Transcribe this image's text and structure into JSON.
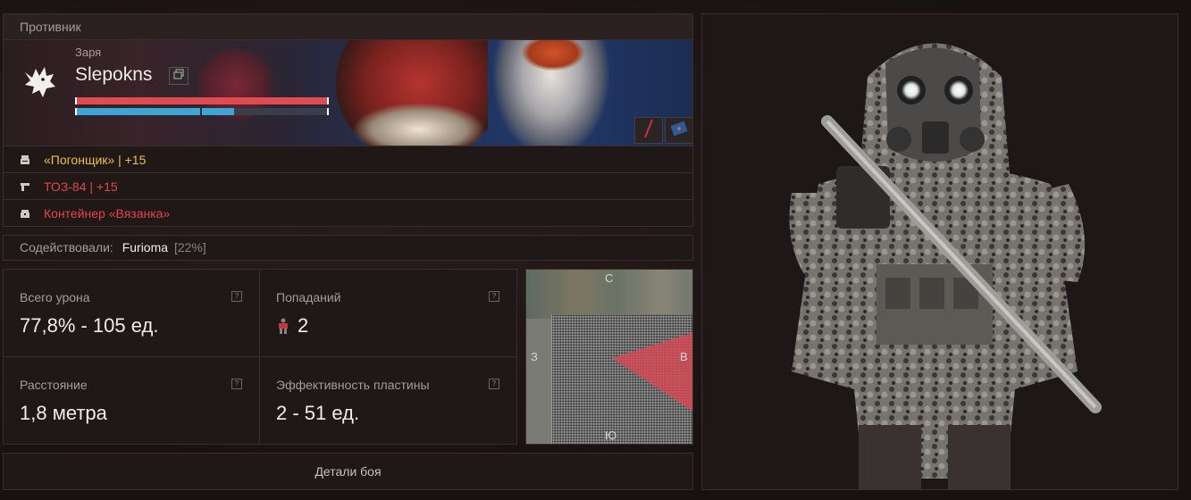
{
  "opponent": {
    "section_title": "Противник",
    "faction": "Заря",
    "nickname": "Slepokns",
    "health_fraction": 1.0,
    "armor_fraction": 0.63,
    "loadout": [
      {
        "icon": "armor-icon",
        "text": "«Погонщик» | +15",
        "color": "#e8c14a"
      },
      {
        "icon": "gun-icon",
        "text": "ТОЗ-84 | +15",
        "color": "#e0464f"
      },
      {
        "icon": "container-icon",
        "text": "Контейнер «Вязанка»",
        "color": "#e0464f"
      }
    ]
  },
  "assisted": {
    "label": "Содействовали:",
    "player": "Furioma",
    "percent": "[22%]"
  },
  "stats": {
    "total_damage": {
      "label": "Всего урона",
      "value": "77,8% - 105 ед."
    },
    "hits": {
      "label": "Попаданий",
      "value": "2"
    },
    "distance": {
      "label": "Расстояние",
      "value": "1,8 метра"
    },
    "plate_efficiency": {
      "label": "Эффективность пластины",
      "value": "2 - 51 ед."
    },
    "help_glyph": "?"
  },
  "minimap": {
    "north": "С",
    "west": "З",
    "east": "В",
    "south": "Ю"
  },
  "details_button": "Детали боя",
  "colors": {
    "health": "#e04b52",
    "armor": "#3aa7d6",
    "orange_item": "#e8c14a",
    "red_item": "#e0464f"
  }
}
